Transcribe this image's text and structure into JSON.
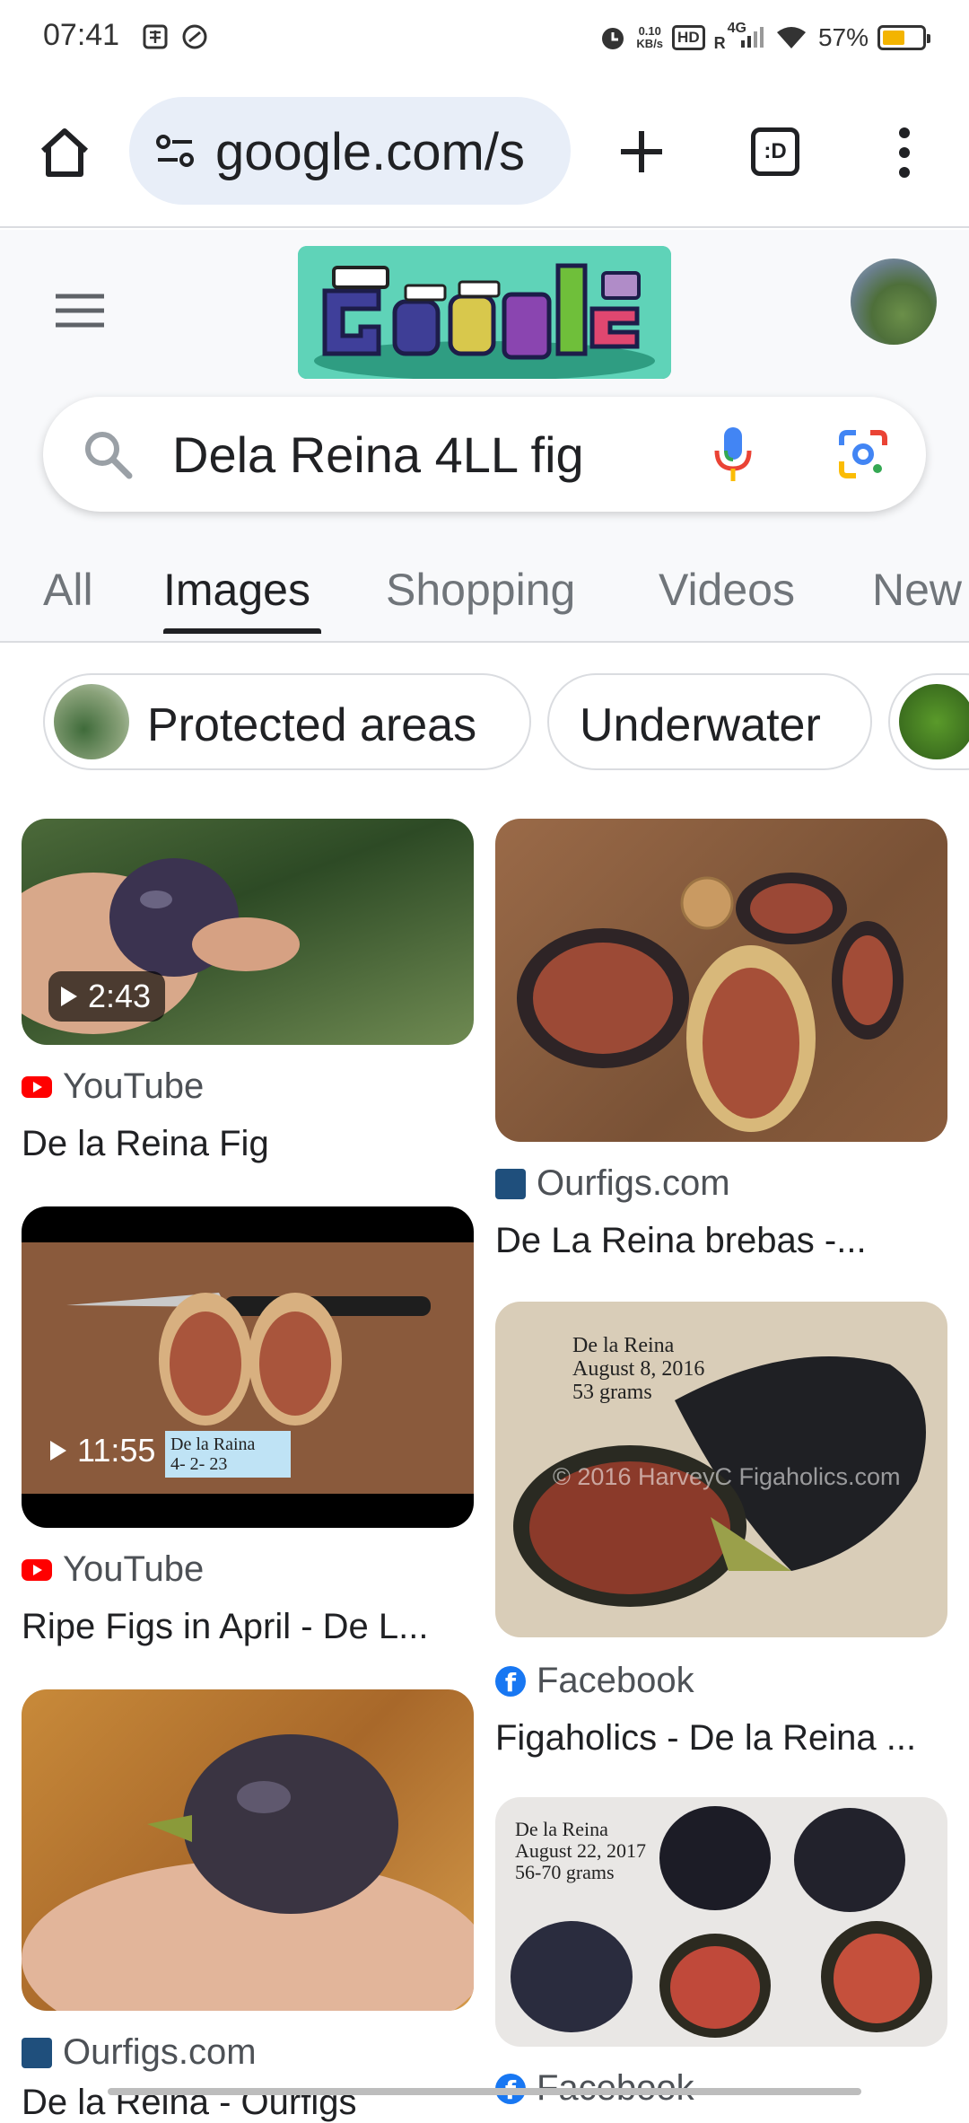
{
  "status_bar": {
    "time": "07:41",
    "net_speed_top": "0.10",
    "net_speed_bottom": "KB/s",
    "hd": "HD",
    "network": "4G",
    "roaming": "R",
    "battery": "57%"
  },
  "browser": {
    "url": "google.com/s",
    "tab_count": ":D",
    "icons": [
      "home-icon",
      "site-info-icon",
      "new-tab-icon",
      "tab-switcher-icon",
      "more-icon"
    ]
  },
  "search": {
    "query": "Dela Reina 4LL fig",
    "icons": [
      "search-icon",
      "mic-icon",
      "lens-icon"
    ]
  },
  "tabs": [
    {
      "label": "All"
    },
    {
      "label": "Images"
    },
    {
      "label": "Shopping"
    },
    {
      "label": "Videos"
    },
    {
      "label": "New"
    }
  ],
  "chips": [
    {
      "label": "Protected areas"
    },
    {
      "label": "Underwater"
    }
  ],
  "results": [
    {
      "source": "YouTube",
      "title": "De la Reina Fig",
      "duration": "2:43"
    },
    {
      "source": "Ourfigs.com",
      "title": "De La Reina brebas -..."
    },
    {
      "source": "YouTube",
      "title": "Ripe Figs in April - De L...",
      "duration": "11:55",
      "image_text": "De la Raina\n4- 2- 23"
    },
    {
      "source": "Facebook",
      "title": "Figaholics - De la Reina ...",
      "image_text": "De la Reina\nAugust 8, 2016\n53 grams",
      "watermark": "© 2016 HarveyC Figaholics.com"
    },
    {
      "source": "Ourfigs.com",
      "title": "De la Reina - Ourfigs"
    },
    {
      "source": "Facebook",
      "image_text": "De la Reina\nAugust 22, 2017\n56-70 grams"
    }
  ],
  "colors": {
    "accent_blue": "#1a73e8",
    "youtube_red": "#ff0000",
    "facebook_blue": "#1877f2",
    "battery_yellow": "#f3b400"
  }
}
